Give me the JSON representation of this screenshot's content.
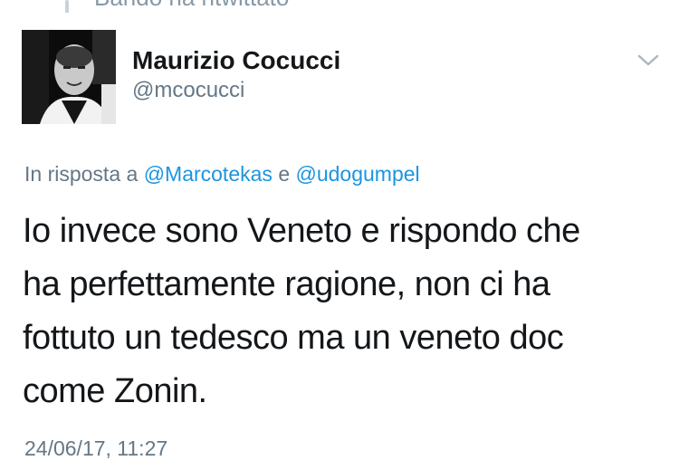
{
  "header": {
    "retweet_text": "Bando ha ritwittato"
  },
  "author": {
    "name": "Maurizio Cocucci",
    "handle": "@mcocucci"
  },
  "reply": {
    "prefix": "In risposta a",
    "mention_1": "@Marcotekas",
    "conjunction": "e",
    "mention_2": "@udogumpel"
  },
  "tweet": {
    "lines": [
      "Io invece sono Veneto e rispondo che",
      "ha perfettamente ragione, non ci ha",
      "fottuto un tedesco ma un veneto doc",
      "come Zonin."
    ]
  },
  "timestamp": "24/06/17, 11:27",
  "icons": {
    "menu": "chevron-down-icon",
    "avatar": "profile-photo"
  },
  "colors": {
    "text": "#14171a",
    "secondary": "#657786",
    "link": "#1b95e0"
  }
}
